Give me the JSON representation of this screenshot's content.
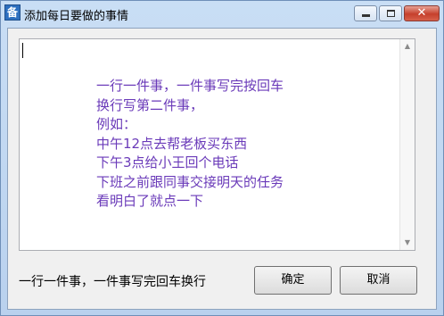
{
  "window": {
    "title": "添加每日要做的事情",
    "icon_glyph": "备",
    "controls": {
      "minimize_icon": "minimize-icon",
      "maximize_icon": "maximize-icon",
      "close_glyph": "✕"
    }
  },
  "memo": {
    "lines": [
      "一行一件事，一件事写完按回车",
      "换行写第二件事，",
      "例如：",
      "中午12点去帮老板买东西",
      "下午3点给小王回个电话",
      "下班之前跟同事交接明天的任务",
      "看明白了就点一下"
    ],
    "text_color": "#6a3ab9",
    "scroll_up_glyph": "▲",
    "scroll_down_glyph": "▼"
  },
  "footer": {
    "hint": "一行一件事，一件事写完回车换行",
    "ok_label": "确定",
    "cancel_label": "取消"
  }
}
